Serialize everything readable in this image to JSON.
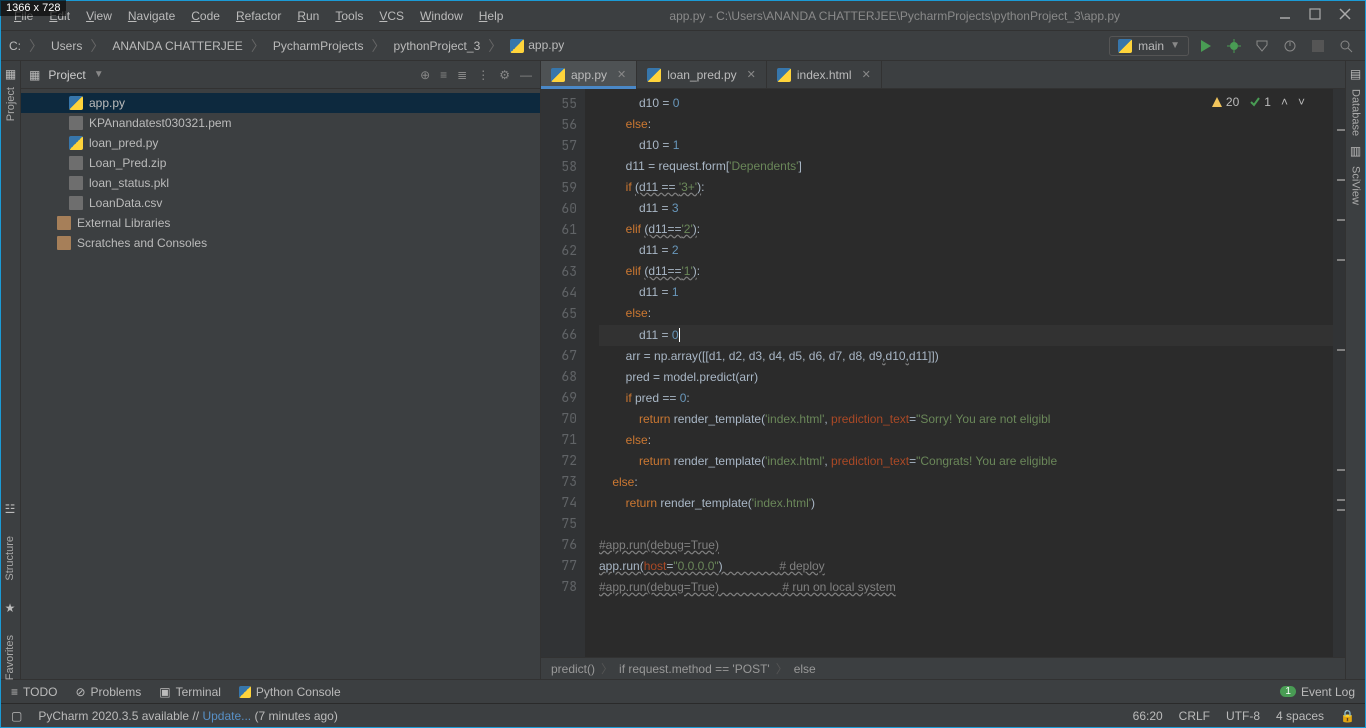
{
  "dim_overlay": "1366 x 728",
  "menu": [
    "File",
    "Edit",
    "View",
    "Navigate",
    "Code",
    "Refactor",
    "Run",
    "Tools",
    "VCS",
    "Window",
    "Help"
  ],
  "title": "app.py - C:\\Users\\ANANDA CHATTERJEE\\PycharmProjects\\pythonProject_3\\app.py",
  "breadcrumbs": [
    "C:",
    "Users",
    "ANANDA CHATTERJEE",
    "PycharmProjects",
    "pythonProject_3",
    "app.py"
  ],
  "run_config": "main",
  "project_label": "Project",
  "tree": [
    {
      "label": "app.py",
      "type": "py",
      "selected": true
    },
    {
      "label": "KPAnandatest030321.pem",
      "type": "file"
    },
    {
      "label": "loan_pred.py",
      "type": "py"
    },
    {
      "label": "Loan_Pred.zip",
      "type": "file"
    },
    {
      "label": "loan_status.pkl",
      "type": "file"
    },
    {
      "label": "LoanData.csv",
      "type": "file"
    },
    {
      "label": "External Libraries",
      "type": "lib",
      "nested": true
    },
    {
      "label": "Scratches and Consoles",
      "type": "lib",
      "nested": true
    }
  ],
  "tabs": [
    {
      "label": "app.py",
      "active": true
    },
    {
      "label": "loan_pred.py"
    },
    {
      "label": "index.html"
    }
  ],
  "line_start": 55,
  "line_end": 78,
  "inspect": {
    "warn": "20",
    "ok": "1"
  },
  "code_crumbs": [
    "predict()",
    "if request.method == 'POST'",
    "else"
  ],
  "bottom": {
    "todo": "TODO",
    "problems": "Problems",
    "terminal": "Terminal",
    "pyconsole": "Python Console",
    "eventlog": "Event Log",
    "eventcount": "1"
  },
  "status": {
    "msg_prefix": "PyCharm 2020.3.5 available // ",
    "msg_link": "Update...",
    "msg_suffix": " (7 minutes ago)",
    "pos": "66:20",
    "sep": "CRLF",
    "enc": "UTF-8",
    "indent": "4 spaces"
  },
  "sidetool": {
    "project": "Project",
    "structure": "Structure",
    "favorites": "Favorites",
    "database": "Database",
    "sciview": "SciView"
  }
}
